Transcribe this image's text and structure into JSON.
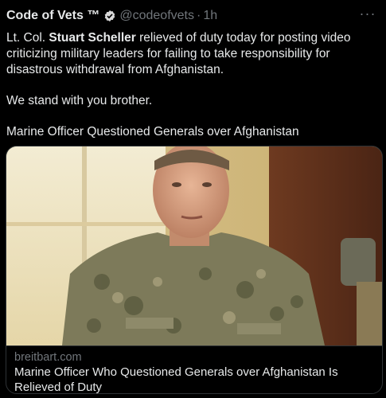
{
  "author": {
    "display_name": "Code of Vets ™",
    "handle": "@codeofvets",
    "separator": "·",
    "time": "1h",
    "verified_icon": "verified-badge-icon"
  },
  "tweet": {
    "line1_prefix": "Lt. Col. ",
    "line1_bold": "Stuart Scheller",
    "line1_rest": " relieved of duty today for posting video criticizing military leaders for failing to take responsibility for disastrous withdrawal from Afghanistan.",
    "line2": "We stand with you brother.",
    "line3": "Marine Officer Questioned Generals over Afghanistan"
  },
  "card": {
    "domain": "breitbart.com",
    "headline": "Marine Officer Who Questioned Generals over Afghanistan Is Relieved of Duty"
  },
  "colors": {
    "background": "#000000",
    "text": "#e7e9ea",
    "secondary": "#71767b",
    "verified": "#d9d9d9"
  }
}
